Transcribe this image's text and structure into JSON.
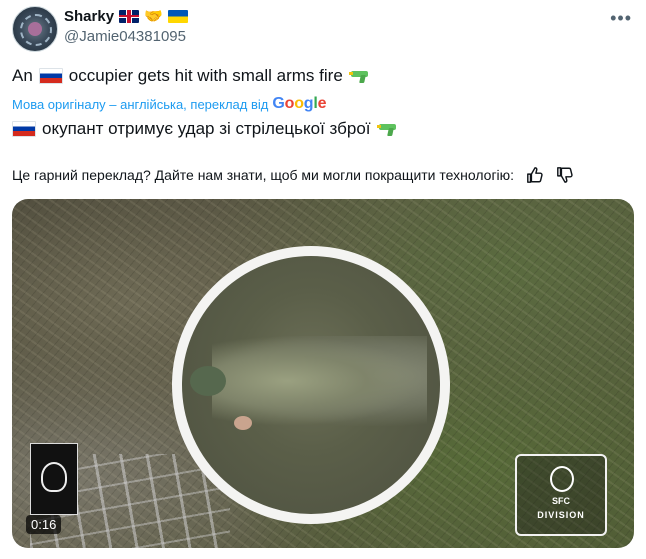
{
  "author": {
    "display_name": "Sharky",
    "handle": "@Jamie04381095",
    "badges": [
      "uk-flag-icon",
      "handshake-icon",
      "ukraine-flag-icon"
    ]
  },
  "post": {
    "original_text": "An 🇷🇺 occupier gets hit with small arms fire 🔫",
    "original_words": [
      "An",
      "occupier gets hit with small arms fire"
    ],
    "translation_note": "Мова оригіналу – англійська, переклад від",
    "translation_provider": "Google",
    "translated_text": "окупант отримує удар зі стрілецької зброї",
    "feedback_prompt": "Це гарний переклад? Дайте нам знати, щоб ми могли покращити технологію:"
  },
  "media": {
    "duration": "0:16",
    "watermark_top": "SFC",
    "watermark_bottom": "DIVISION"
  },
  "colors": {
    "link": "#1d9bf0",
    "text": "#0f1419",
    "secondary": "#536471"
  },
  "icons": [
    "avatar",
    "more-options-icon",
    "russia-flag-icon",
    "water-gun-icon",
    "thumbs-up-icon",
    "thumbs-down-icon"
  ]
}
